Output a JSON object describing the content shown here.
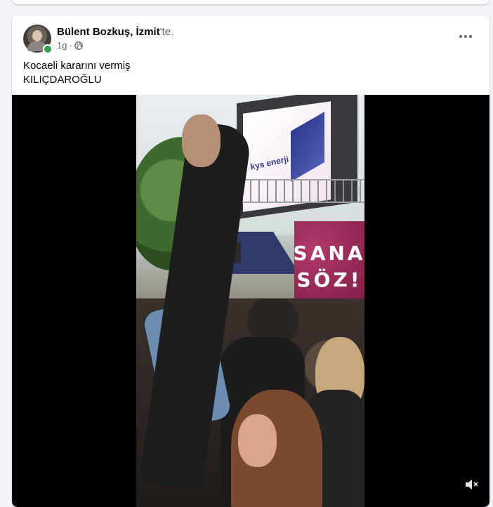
{
  "post": {
    "author": "Bülent Bozkuş",
    "location_separator": ", ",
    "location": "İzmit",
    "location_suffix": "'te.",
    "timestamp": "1g",
    "meta_separator": "·",
    "privacy_icon": "globe-icon",
    "more_icon": "more-options-icon",
    "caption_line1": "Kocaeli kararını vermiş",
    "caption_line2": "KILIÇDAROĞLU",
    "online_status_color": "#31a24c"
  },
  "video": {
    "led_text_line1": "SANA",
    "led_text_line2": "SÖZ!",
    "billboard_text": "kys enerji",
    "volume_icon": "volume-muted-icon"
  }
}
